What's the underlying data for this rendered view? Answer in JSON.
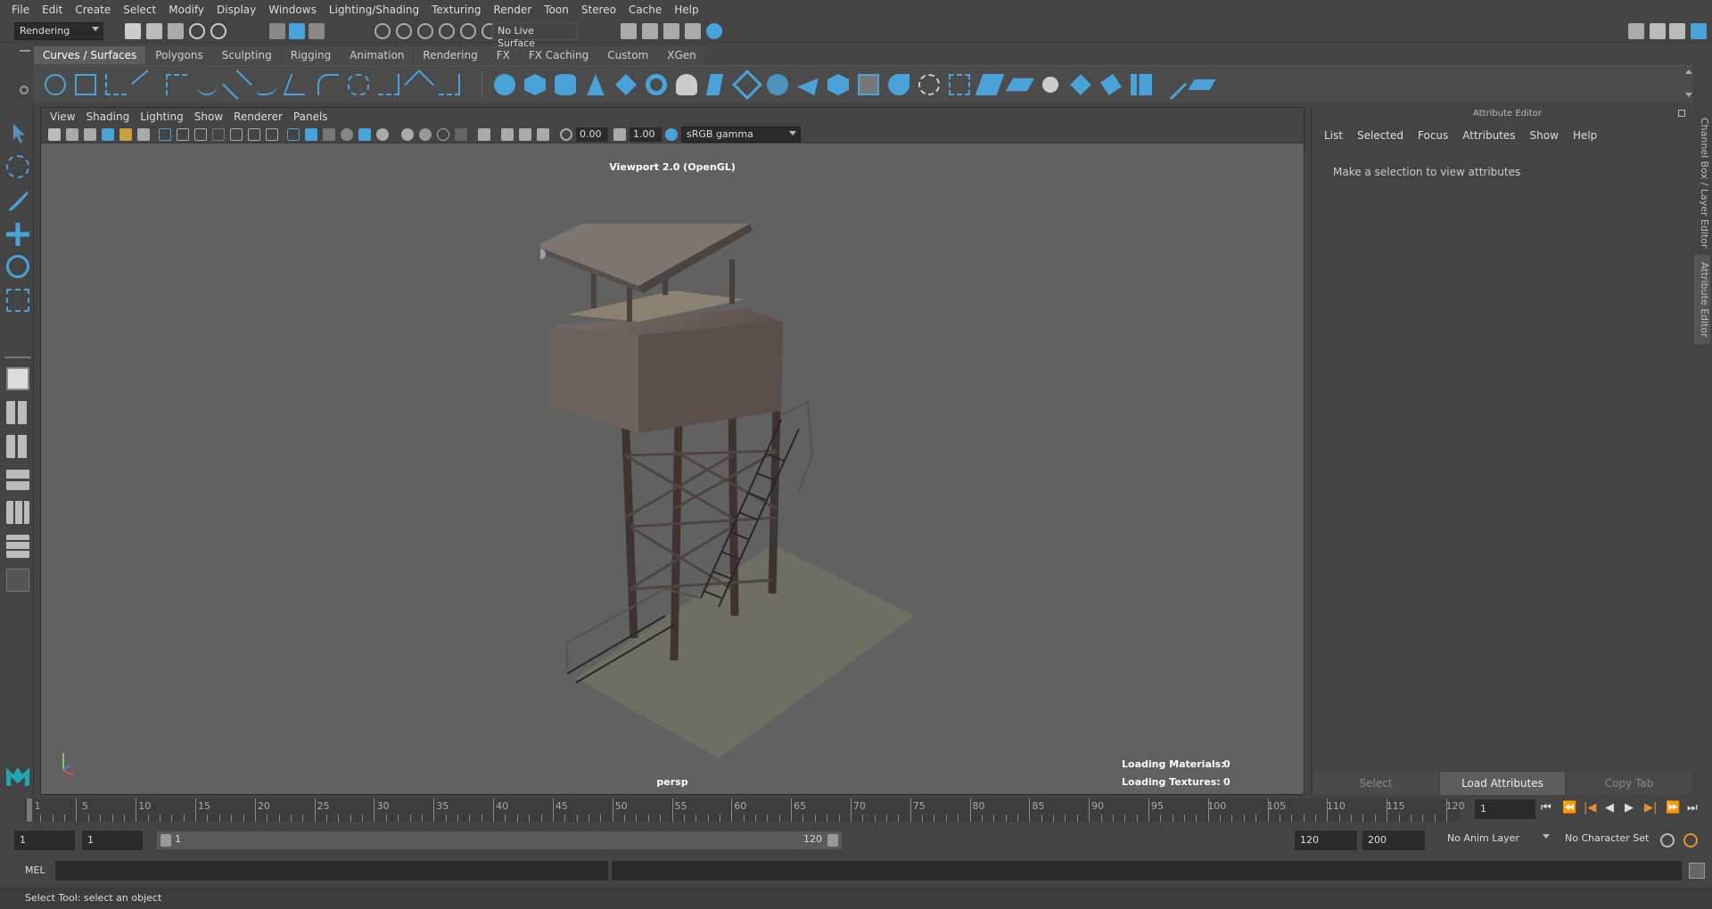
{
  "menubar": {
    "items": [
      "File",
      "Edit",
      "Create",
      "Select",
      "Modify",
      "Display",
      "Windows",
      "Lighting/Shading",
      "Texturing",
      "Render",
      "Toon",
      "Stereo",
      "Cache",
      "Help"
    ]
  },
  "statusline": {
    "menuset": "Rendering",
    "live_surface": "No Live Surface"
  },
  "shelf": {
    "tabs": [
      "Curves / Surfaces",
      "Polygons",
      "Sculpting",
      "Rigging",
      "Animation",
      "Rendering",
      "FX",
      "FX Caching",
      "Custom",
      "XGen"
    ],
    "active_tab": "Curves / Surfaces"
  },
  "viewport": {
    "menu": [
      "View",
      "Shading",
      "Lighting",
      "Show",
      "Renderer",
      "Panels"
    ],
    "exposure": "0.00",
    "gamma": "1.00",
    "colorspace": "sRGB gamma",
    "renderer_label": "Viewport 2.0 (OpenGL)",
    "camera": "persp",
    "loading_materials_label": "Loading Materials:",
    "loading_materials_value": "0",
    "loading_textures_label": "Loading Textures:",
    "loading_textures_value": "0"
  },
  "attribute_editor": {
    "title": "Attribute Editor",
    "menu": [
      "List",
      "Selected",
      "Focus",
      "Attributes",
      "Show",
      "Help"
    ],
    "message": "Make a selection to view attributes",
    "buttons": [
      "Select",
      "Load Attributes",
      "Copy Tab"
    ]
  },
  "side_tabs": {
    "channel_box": "Channel Box / Layer Editor",
    "attribute_editor": "Attribute Editor"
  },
  "timeslider": {
    "ticks": [
      "1",
      "5",
      "10",
      "15",
      "20",
      "25",
      "30",
      "35",
      "40",
      "45",
      "50",
      "55",
      "60",
      "65",
      "70",
      "75",
      "80",
      "85",
      "90",
      "95",
      "100",
      "105",
      "110",
      "115",
      "120"
    ],
    "current_frame": "1"
  },
  "range": {
    "start": "1",
    "playback_start": "1",
    "range_start": "1",
    "range_end": "120",
    "playback_end": "120",
    "end": "200",
    "anim_layer": "No Anim Layer",
    "character_set": "No Character Set"
  },
  "commandline": {
    "language": "MEL"
  },
  "helpline": {
    "text": "Select Tool: select an object"
  },
  "colors": {
    "accent": "#4aa3d8",
    "viewport_bg": "#616161"
  }
}
